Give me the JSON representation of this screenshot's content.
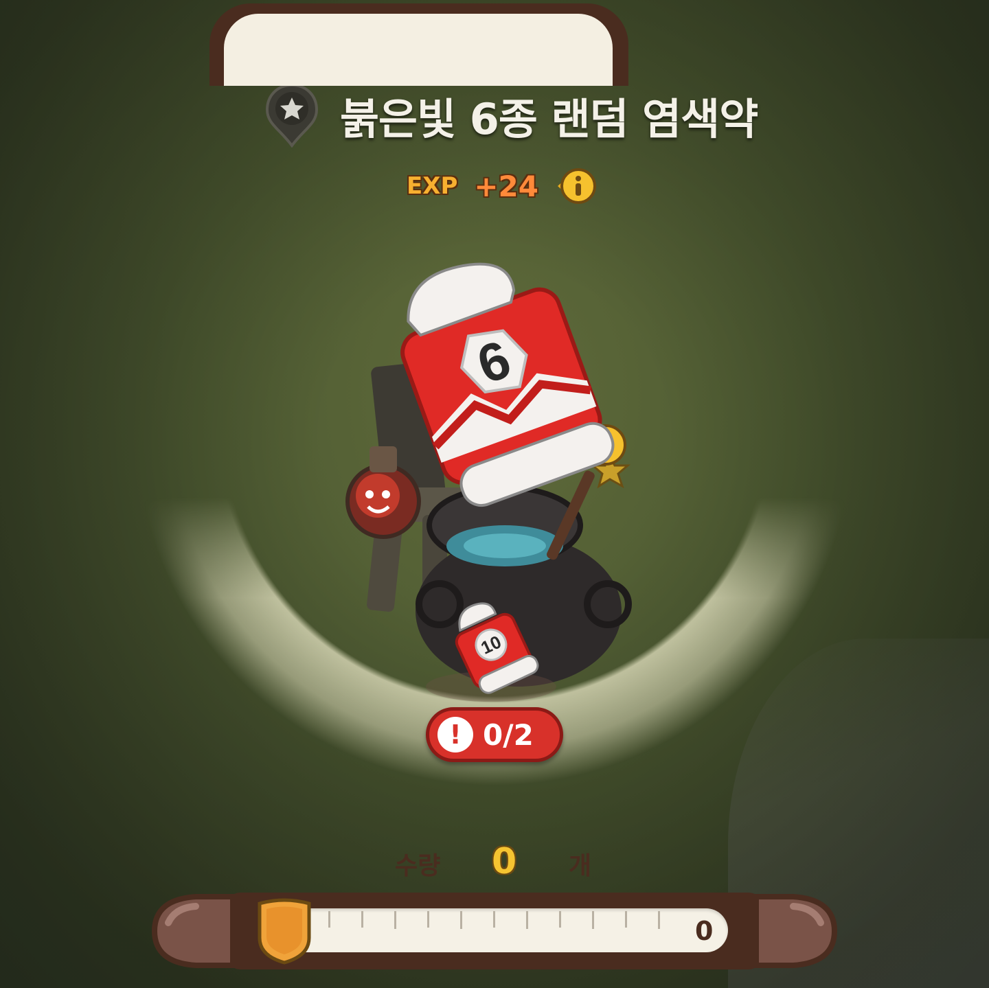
{
  "item": {
    "name": "붉은빛 6종 랜덤 염색약",
    "icon": "star-pin-icon"
  },
  "exp": {
    "label": "EXP",
    "value": "+24",
    "info_icon": "info-icon"
  },
  "product": {
    "main_label": "6",
    "ingredient_label": "10"
  },
  "requirement": {
    "icon": "alert-icon",
    "count": "0/2"
  },
  "quantity": {
    "label": "수량",
    "value": "0",
    "unit": "개",
    "max": "0",
    "slider_fraction": 0
  },
  "colors": {
    "accent_red": "#d8312a",
    "panel_brown": "#4a2c1f",
    "gold": "#f5c431"
  }
}
